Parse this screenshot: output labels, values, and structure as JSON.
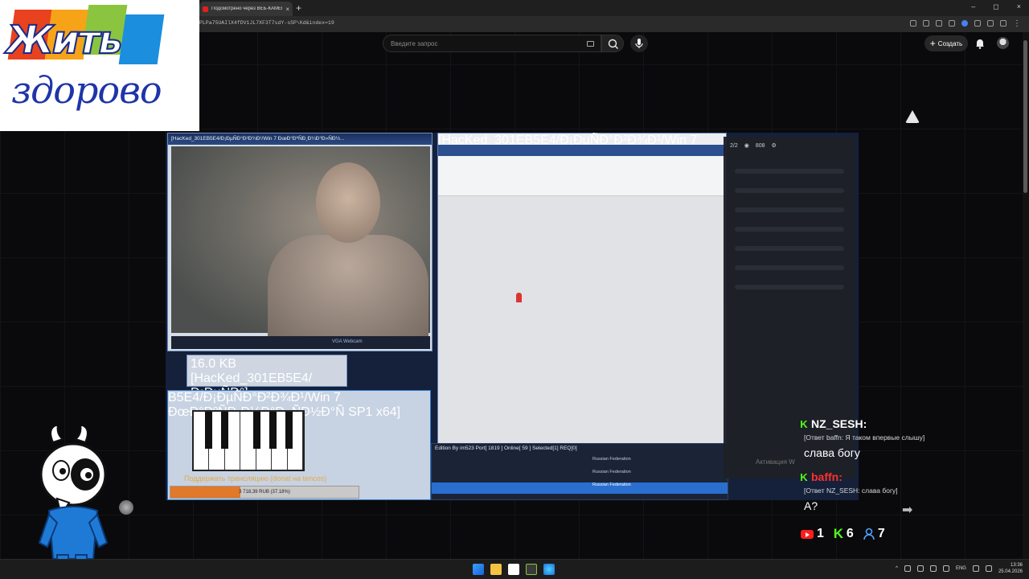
{
  "browser": {
    "tab_title": "Подсмотрено через ВЕБ-КАМЕР",
    "tab_close": "×",
    "new_tab": "+",
    "url": "PLPa75UAIlX4fDV1JL7XF3T7sdY-sSP\\Kd&index=19",
    "window_controls": [
      "–",
      "◻",
      "×"
    ]
  },
  "youtube": {
    "search_placeholder": "Введите запрос",
    "create_label": "Создать",
    "create_plus": "+"
  },
  "logo": {
    "line1": "Жить",
    "line2": "здорово",
    "colors": [
      "#e8421f",
      "#f7a318",
      "#8bc53f",
      "#1b8ede",
      "#a43c96"
    ]
  },
  "video": {
    "webcam_window_title": "[HacKed_301EB5E4/Ð¡ÐµÑÐ°Ð²Ð¾Ð¹/Win 7 ÐœÐ°ÐºÑÐ¸Ð¼Ð°Ð»ÑÐ½...",
    "webcam_toolbar": "VGA Webcam",
    "word_window_title": "[HacKed_301EB5E4/Ð¡ÐµÑÐ°Ð²Ð¾Ð¹/Win 7 ÐœÐ°ÐºÑÐ¸Ð¼Ð°Ð»ÑÐ½Ð°Ñ SP1 x64]",
    "download_title": "16.0 KB [HacKed_301EB5E4/Ð¡ÐµÑÐ°]",
    "piano_window_title": "B5E4/Ð¡ÐµÑÐ°Ð²Ð¾Ð¹/Win 7 ÐœÐ°ÐºÑÐ¸Ð¼Ð°Ð»ÑÐ½Ð°Ñ SP1 x64]",
    "donation_overlay": "Поддержать трансляцию (donat на tencos)",
    "progress_text": "3 718,39 RUB (37.18%)",
    "progress_fraction": 0.3718,
    "rat_status": "Edition By im523   Port[ 1819 ]   Online[ 59 ]   Selected[1] REQ[0]",
    "rat_rows": [
      "Russian Federation",
      "Russian Federation",
      "Russian Federation"
    ],
    "panel_top": "2/2",
    "panel_views": "808",
    "activation": "Активация W"
  },
  "chat": {
    "messages": [
      {
        "user": "NZ_SESH:",
        "reply": "[Ответ baffn: Я таком впервые слышу]",
        "text": "слава богу",
        "user_color": "#ffffff"
      },
      {
        "user": "baffn:",
        "reply": "[Ответ NZ_SESH: слава богу]",
        "text": "А?",
        "user_color": "#ff3030"
      }
    ]
  },
  "stats": {
    "youtube_count": "1",
    "kick_count": "6",
    "viewers_count": "7"
  },
  "taskbar": {
    "lang": "ENG",
    "time": "13:36",
    "date": "25.04.2026"
  }
}
